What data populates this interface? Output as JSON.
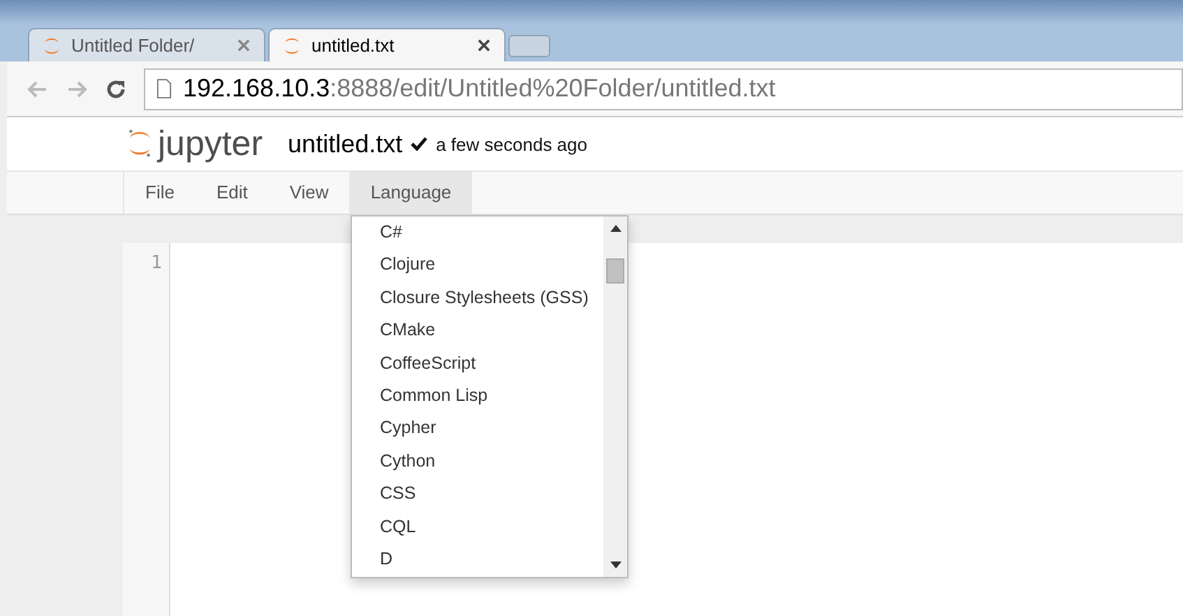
{
  "browser_tabs": [
    {
      "title": "Untitled Folder/",
      "selected": false
    },
    {
      "title": "untitled.txt",
      "selected": true
    }
  ],
  "address_bar": {
    "host": "192.168.10.3",
    "rest": ":8888/edit/Untitled%20Folder/untitled.txt"
  },
  "header": {
    "logo_text": "jupyter",
    "filename": "untitled.txt",
    "saved": true,
    "save_status": "a few seconds ago"
  },
  "menu": [
    {
      "label": "File",
      "selected": false
    },
    {
      "label": "Edit",
      "selected": false
    },
    {
      "label": "View",
      "selected": false
    },
    {
      "label": "Language",
      "selected": true
    }
  ],
  "language_dropdown": [
    "C#",
    "Clojure",
    "Closure Stylesheets (GSS)",
    "CMake",
    "CoffeeScript",
    "Common Lisp",
    "Cypher",
    "Cython",
    "CSS",
    "CQL",
    "D"
  ],
  "editor": {
    "line_numbers": [
      "1"
    ]
  }
}
